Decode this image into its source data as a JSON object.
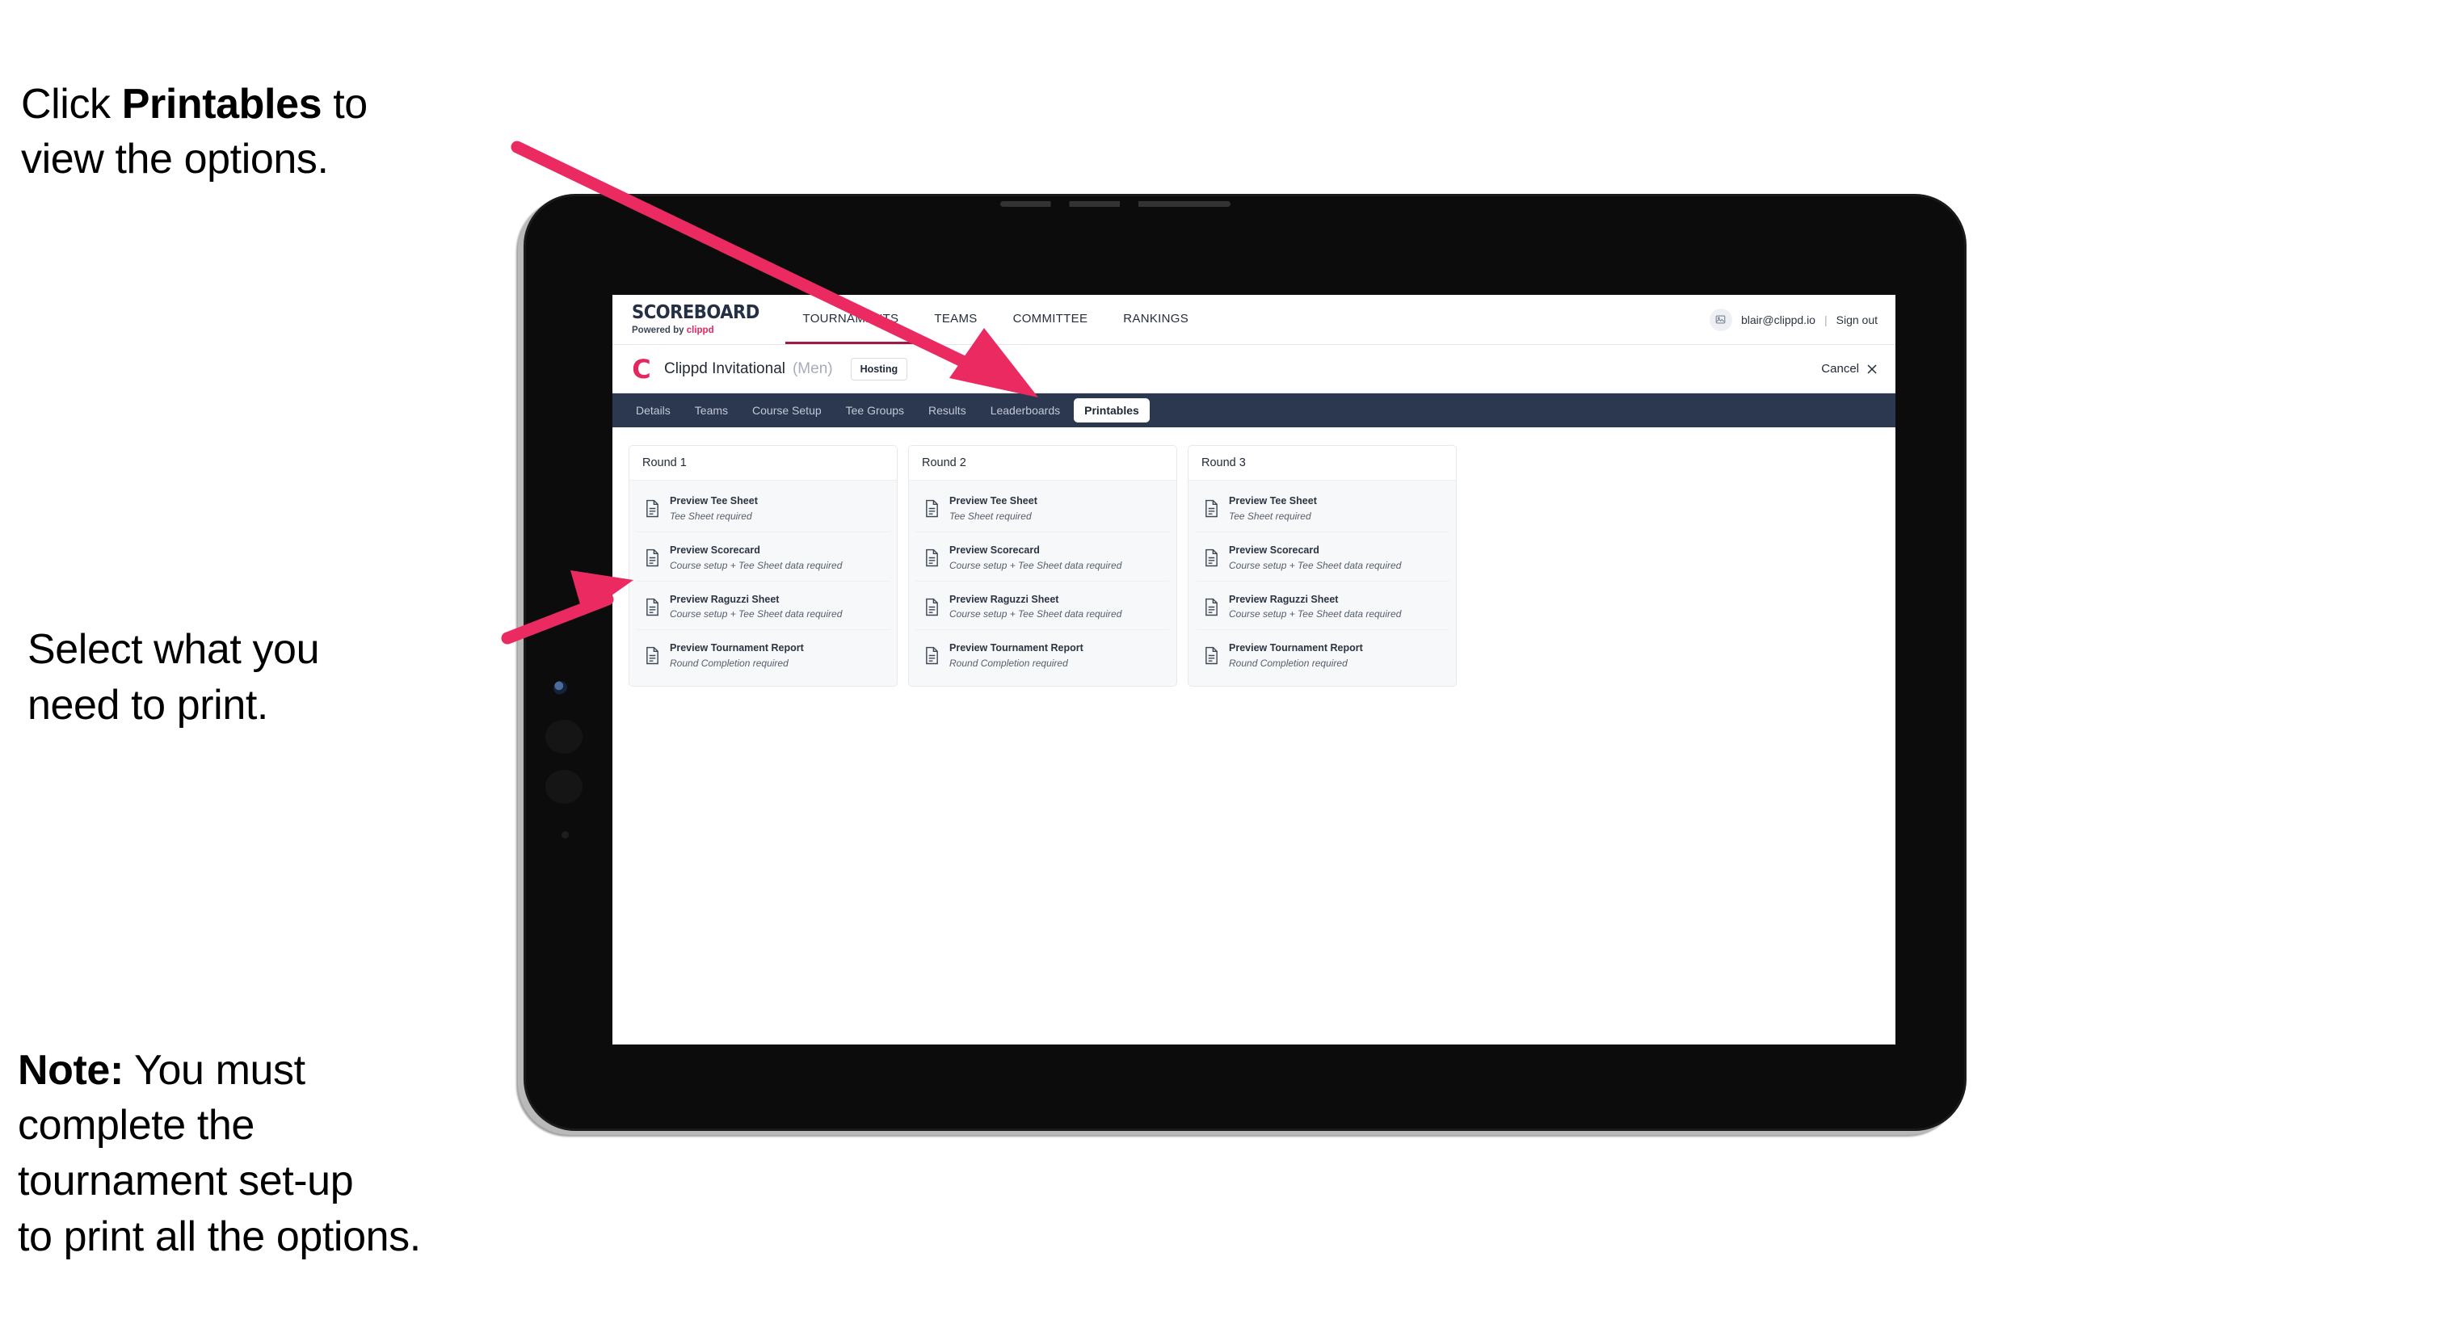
{
  "annotations": {
    "click_printables": {
      "prefix": "Click ",
      "bold": "Printables",
      "suffix": " to\nview the options."
    },
    "select_print": "Select what you\n need to print.",
    "note": {
      "bold": "Note:",
      "text": " You must\ncomplete the\ntournament set-up\nto print all the options."
    }
  },
  "app": {
    "brand": {
      "name": "SCOREBOARD",
      "powered_by_prefix": "Powered by ",
      "powered_by_brand": "clippd"
    },
    "top_nav": [
      {
        "label": "TOURNAMENTS",
        "active": true
      },
      {
        "label": "TEAMS",
        "active": false
      },
      {
        "label": "COMMITTEE",
        "active": false
      },
      {
        "label": "RANKINGS",
        "active": false
      }
    ],
    "user": {
      "avatar_icon": "user-image-icon",
      "email": "blair@clippd.io",
      "separator": "|",
      "sign_out": "Sign out"
    },
    "tournament": {
      "logo_letter": "C",
      "name": "Clippd Invitational",
      "gender": "(Men)",
      "status_badge": "Hosting",
      "cancel_label": "Cancel",
      "cancel_icon": "close-icon"
    },
    "tabs": [
      {
        "label": "Details",
        "active": false
      },
      {
        "label": "Teams",
        "active": false
      },
      {
        "label": "Course Setup",
        "active": false
      },
      {
        "label": "Tee Groups",
        "active": false
      },
      {
        "label": "Results",
        "active": false
      },
      {
        "label": "Leaderboards",
        "active": false
      },
      {
        "label": "Printables",
        "active": true
      }
    ],
    "rounds": [
      {
        "title": "Round 1",
        "items": [
          {
            "title": "Preview Tee Sheet",
            "sub": "Tee Sheet required",
            "icon": "document-icon"
          },
          {
            "title": "Preview Scorecard",
            "sub": "Course setup + Tee Sheet data required",
            "icon": "document-icon"
          },
          {
            "title": "Preview Raguzzi Sheet",
            "sub": "Course setup + Tee Sheet data required",
            "icon": "document-icon"
          },
          {
            "title": "Preview Tournament Report",
            "sub": "Round Completion required",
            "icon": "document-icon"
          }
        ]
      },
      {
        "title": "Round 2",
        "items": [
          {
            "title": "Preview Tee Sheet",
            "sub": "Tee Sheet required",
            "icon": "document-icon"
          },
          {
            "title": "Preview Scorecard",
            "sub": "Course setup + Tee Sheet data required",
            "icon": "document-icon"
          },
          {
            "title": "Preview Raguzzi Sheet",
            "sub": "Course setup + Tee Sheet data required",
            "icon": "document-icon"
          },
          {
            "title": "Preview Tournament Report",
            "sub": "Round Completion required",
            "icon": "document-icon"
          }
        ]
      },
      {
        "title": "Round 3",
        "items": [
          {
            "title": "Preview Tee Sheet",
            "sub": "Tee Sheet required",
            "icon": "document-icon"
          },
          {
            "title": "Preview Scorecard",
            "sub": "Course setup + Tee Sheet data required",
            "icon": "document-icon"
          },
          {
            "title": "Preview Raguzzi Sheet",
            "sub": "Course setup + Tee Sheet data required",
            "icon": "document-icon"
          },
          {
            "title": "Preview Tournament Report",
            "sub": "Round Completion required",
            "icon": "document-icon"
          }
        ]
      }
    ]
  },
  "colors": {
    "accent_pink": "#ec2a62",
    "clippd_pink": "#e5275f",
    "tab_bar_dark": "#2c3850",
    "nav_underline": "#9e1b45",
    "text_dark": "#232b37"
  }
}
